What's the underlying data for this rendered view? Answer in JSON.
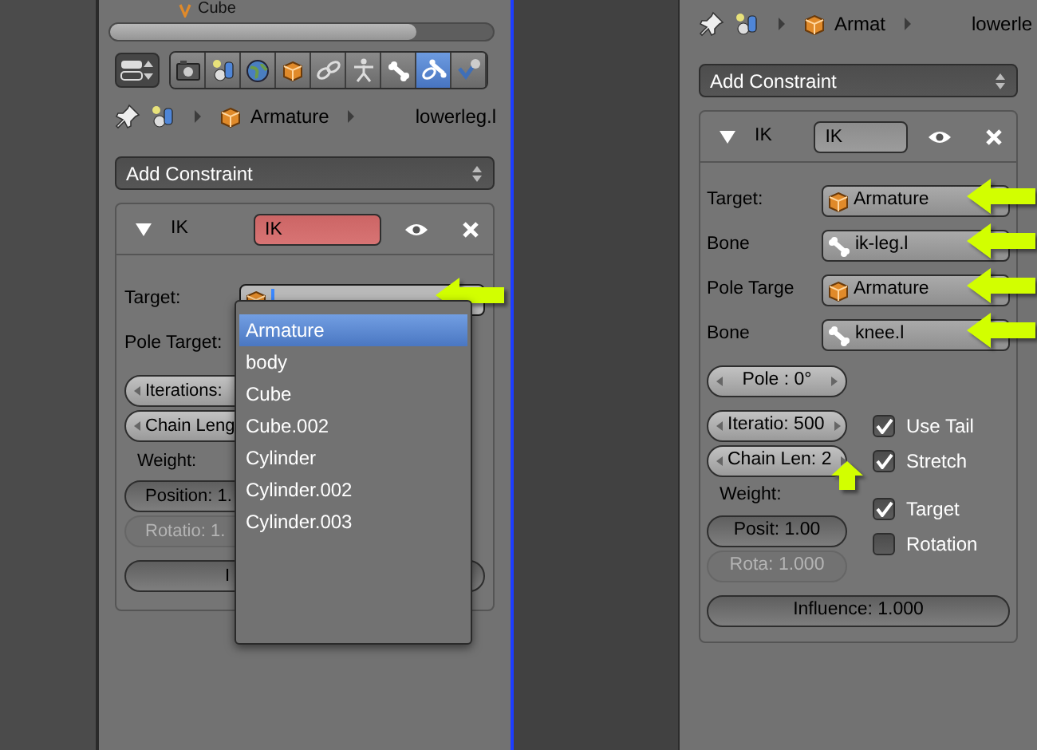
{
  "left_panel": {
    "header": {
      "object": "Cube"
    },
    "tabs": [
      {
        "kind": "render",
        "selected": false
      },
      {
        "kind": "scene",
        "selected": false
      },
      {
        "kind": "world",
        "selected": false
      },
      {
        "kind": "object",
        "selected": false
      },
      {
        "kind": "constraints",
        "selected": false
      },
      {
        "kind": "data",
        "selected": false
      },
      {
        "kind": "bone",
        "selected": false
      },
      {
        "kind": "bone_constraints",
        "selected": true
      },
      {
        "kind": "modifier",
        "selected": false
      }
    ],
    "breadcrumb": {
      "object": "Armature",
      "bone": "lowerleg.l"
    },
    "add_constraint": "Add Constraint",
    "constraint": {
      "type": "IK",
      "name": "IK",
      "error": true,
      "fields": [
        {
          "kind": "object",
          "label": "Target:",
          "editing": true,
          "pointer": true
        },
        {
          "kind": "label",
          "label": "Pole Target:",
          "editing": false,
          "pointer": false
        }
      ],
      "settings": [
        {
          "kind": "number",
          "text": "Iterations:",
          "disabled": false,
          "pointer": false
        },
        {
          "kind": "number",
          "text": "Chain Leng",
          "disabled": false,
          "pointer": false
        },
        {
          "kind": "label",
          "text": "Weight:",
          "disabled": false,
          "pointer": false
        },
        {
          "kind": "slider",
          "text": "Position: 1.",
          "disabled": false,
          "pointer": false
        },
        {
          "kind": "slider",
          "text": "Rotatio: 1.",
          "disabled": true,
          "pointer": false
        }
      ],
      "influence": "I"
    },
    "menu": {
      "items": [
        {
          "label": "Armature",
          "selected": true
        },
        {
          "label": "body",
          "selected": false
        },
        {
          "label": "Cube",
          "selected": false
        },
        {
          "label": "Cube.002",
          "selected": false
        },
        {
          "label": "Cylinder",
          "selected": false
        },
        {
          "label": "Cylinder.002",
          "selected": false
        },
        {
          "label": "Cylinder.003",
          "selected": false
        }
      ]
    }
  },
  "right_panel": {
    "breadcrumb": {
      "object": "Armat",
      "bone": "lowerle"
    },
    "add_constraint": "Add Constraint",
    "constraint": {
      "type": "IK",
      "name": "IK",
      "error": false,
      "fields": [
        {
          "kind": "object",
          "label": "Target:",
          "value": "Armature",
          "editing": false,
          "pointer": true
        },
        {
          "kind": "bone",
          "label": "Bone",
          "value": "ik-leg.l",
          "editing": false,
          "pointer": true
        },
        {
          "kind": "object",
          "label": "Pole Targe",
          "value": "Armature",
          "editing": false,
          "pointer": true
        },
        {
          "kind": "bone",
          "label": "Bone",
          "value": "knee.l",
          "editing": false,
          "pointer": true
        }
      ],
      "pole": "Pole : 0°",
      "settings": [
        {
          "kind": "number",
          "text": "Iteratio: 500",
          "disabled": false,
          "pointer": false
        },
        {
          "kind": "number",
          "text": "Chain Len: 2",
          "disabled": false,
          "pointer": true
        },
        {
          "kind": "label",
          "text": "Weight:",
          "disabled": false,
          "pointer": false
        },
        {
          "kind": "slider",
          "text": "Posit: 1.00",
          "disabled": false,
          "pointer": false
        },
        {
          "kind": "slider",
          "text": "Rota: 1.000",
          "disabled": true,
          "pointer": false
        }
      ],
      "checks": [
        {
          "label": "Use Tail",
          "checked": true
        },
        {
          "label": "Stretch",
          "checked": true
        },
        {
          "label": "Target",
          "checked": true
        },
        {
          "label": "Rotation",
          "checked": false
        }
      ],
      "influence": "Influence: 1.000"
    }
  }
}
